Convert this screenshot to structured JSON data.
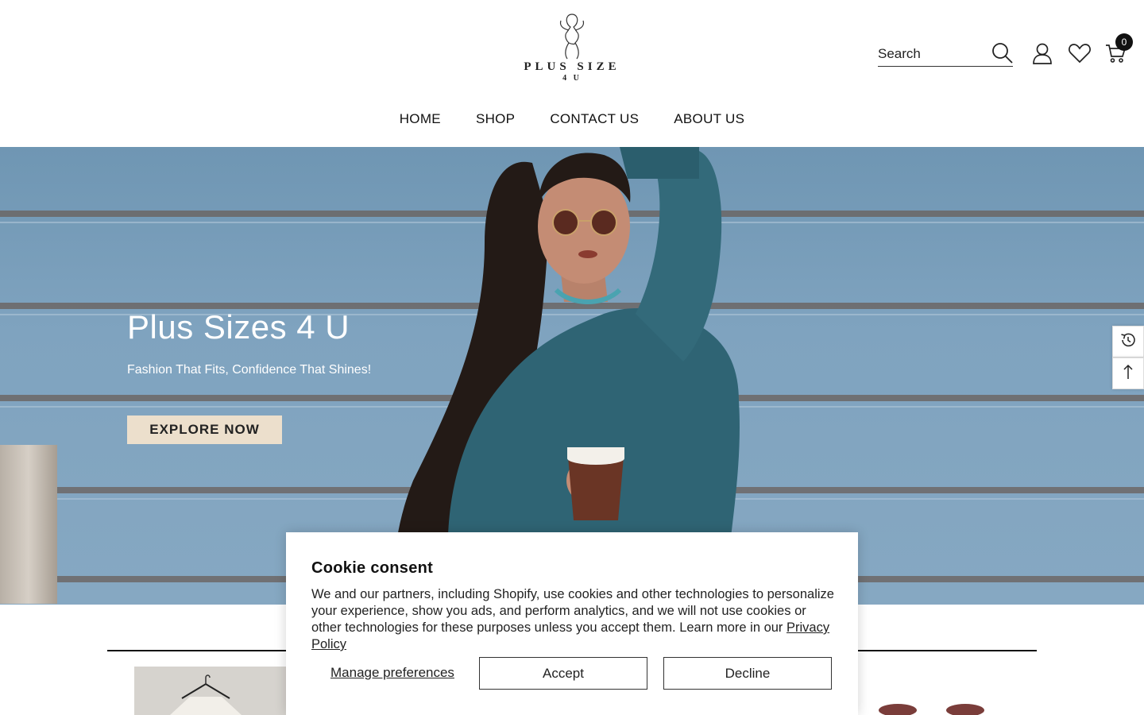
{
  "header": {
    "logo_text": "PLUS SIZE",
    "logo_sub": "4 U",
    "search_placeholder": "Search",
    "cart_count": "0"
  },
  "nav": {
    "items": [
      {
        "label": "HOME"
      },
      {
        "label": "SHOP"
      },
      {
        "label": "CONTACT US"
      },
      {
        "label": "ABOUT US"
      }
    ]
  },
  "hero": {
    "title": "Plus Sizes 4 U",
    "subtitle": "Fashion That Fits, Confidence That Shines!",
    "button_label": "EXPLORE NOW"
  },
  "cookie": {
    "title": "Cookie consent",
    "body": "We and our partners, including Shopify, use cookies and other technologies to personalize your experience, show you ads, and perform analytics, and we will not use cookies or other technologies for these purposes unless you accept them. Learn more in our ",
    "link_label": "Privacy Policy",
    "manage_label": "Manage preferences",
    "accept_label": "Accept",
    "decline_label": "Decline"
  },
  "colors": {
    "hero_button_bg": "#ecdfcc",
    "cart_badge_bg": "#111111",
    "hero_wall": "#7fa3bf"
  },
  "icons": [
    "search-icon",
    "account-icon",
    "wishlist-icon",
    "cart-icon",
    "recently-viewed-icon",
    "arrow-up-icon"
  ]
}
